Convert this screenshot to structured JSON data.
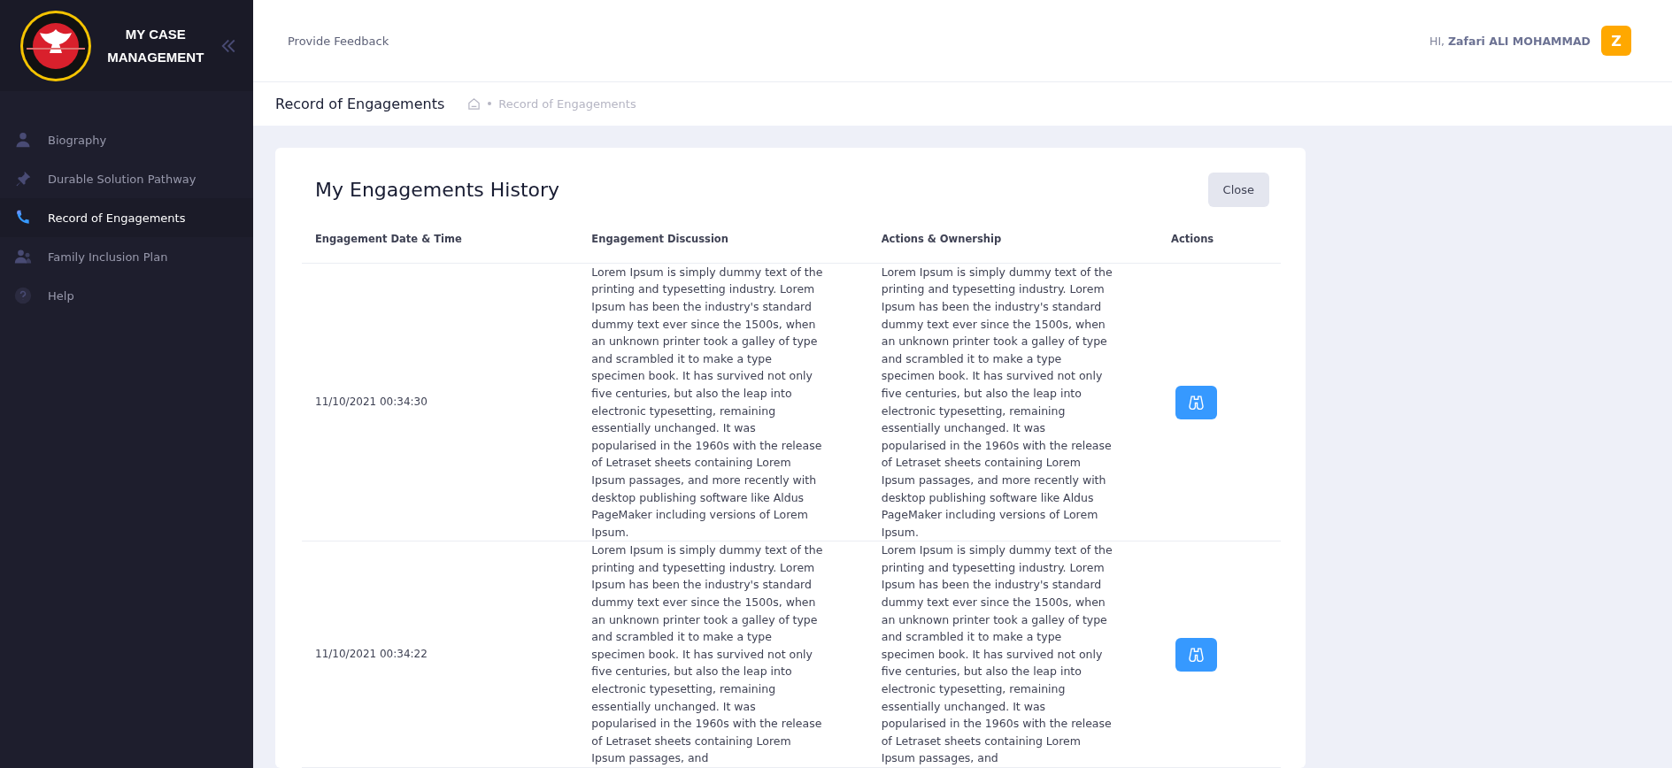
{
  "sidebar": {
    "brand": "MY CASE MANAGEMENT",
    "items": [
      {
        "label": "Biography",
        "selected": false
      },
      {
        "label": "Durable Solution Pathway",
        "selected": false
      },
      {
        "label": "Record of Engagements",
        "selected": true
      },
      {
        "label": "Family Inclusion Plan",
        "selected": false
      },
      {
        "label": "Help",
        "selected": false
      }
    ]
  },
  "header": {
    "feedback_link": "Provide Feedback",
    "greeting": "HI, **Zafari ALI MOHAMMAD**",
    "avatar": "Z"
  },
  "subheader": {
    "title": "Record of Engagements",
    "breadcrumb": "Record of Engagements"
  },
  "card": {
    "title": "My Engagements History",
    "close_button": "Close",
    "table": {
      "columns": [
        "Engagement Date & Time",
        "Engagement Discussion",
        "Actions & Ownership",
        "Actions"
      ],
      "rows": [
        {
          "date": "11/10/2021 00:34:30",
          "discussion": "Lorem Ipsum is simply dummy text of the printing and typesetting industry. Lorem Ipsum has been the industry's standard dummy text ever since the 1500s, when an unknown printer took a galley of type and scrambled it to make a type specimen book. It has survived not only five centuries, but also the leap into electronic typesetting, remaining essentially unchanged. It was popularised in the 1960s with the release of Letraset sheets containing Lorem Ipsum passages, and more recently with desktop publishing software like Aldus PageMaker including versions of Lorem Ipsum.",
          "actions_ownership": "Lorem Ipsum is simply dummy text of the printing and typesetting industry. Lorem Ipsum has been the industry's standard dummy text ever since the 1500s, when an unknown printer took a galley of type and scrambled it to make a type specimen book. It has survived not only five centuries, but also the leap into electronic typesetting, remaining essentially unchanged. It was popularised in the 1960s with the release of Letraset sheets containing Lorem Ipsum passages, and more recently with desktop publishing software like Aldus PageMaker including versions of Lorem Ipsum."
        },
        {
          "date": "11/10/2021 00:34:22",
          "discussion": "Lorem Ipsum is simply dummy text of the printing and typesetting industry. Lorem Ipsum has been the industry's standard dummy text ever since the 1500s, when an unknown printer took a galley of type and scrambled it to make a type specimen book. It has survived not only five centuries, but also the leap into electronic typesetting, remaining essentially unchanged. It was popularised in the 1960s with the release of Letraset sheets containing Lorem Ipsum passages, and",
          "actions_ownership": "Lorem Ipsum is simply dummy text of the printing and typesetting industry. Lorem Ipsum has been the industry's standard dummy text ever since the 1500s, when an unknown printer took a galley of type and scrambled it to make a type specimen book. It has survived not only five centuries, but also the leap into electronic typesetting, remaining essentially unchanged. It was popularised in the 1960s with the release of Letraset sheets containing Lorem Ipsum passages, and"
        }
      ]
    }
  }
}
